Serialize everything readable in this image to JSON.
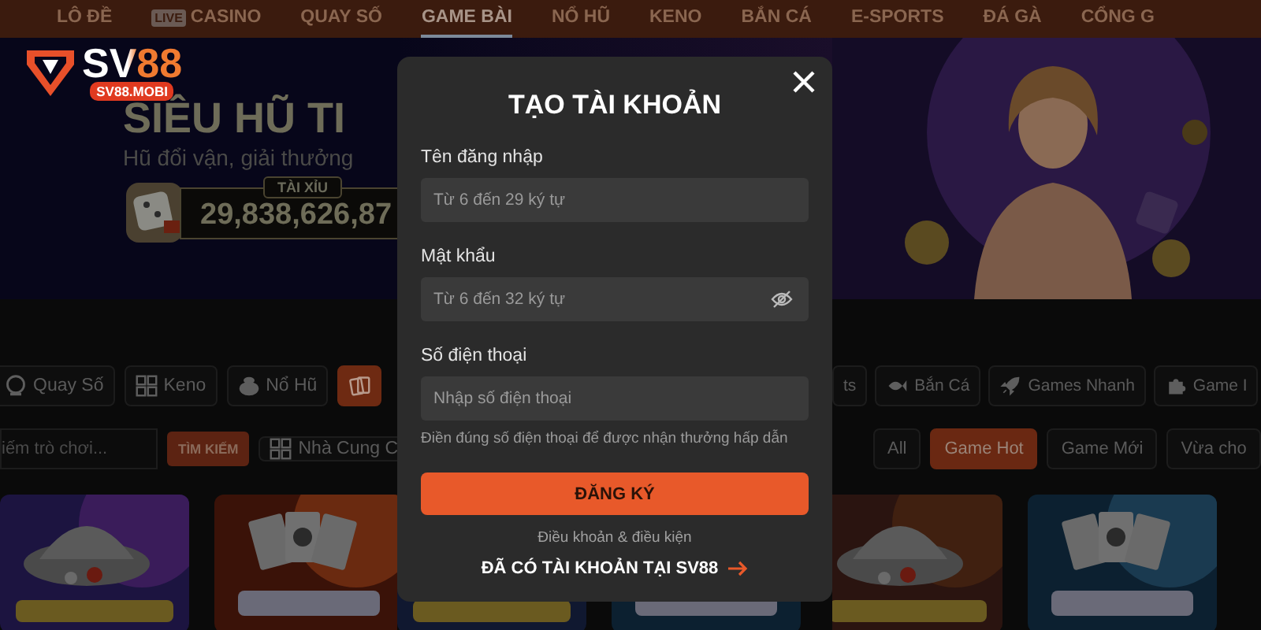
{
  "nav": {
    "items": [
      {
        "label": "LÔ ĐỀ",
        "selected": false
      },
      {
        "label": "CASINO",
        "badge": "LIVE",
        "selected": false
      },
      {
        "label": "QUAY SỐ",
        "selected": false
      },
      {
        "label": "GAME BÀI",
        "selected": true
      },
      {
        "label": "NỔ HŨ",
        "selected": false
      },
      {
        "label": "KENO",
        "selected": false
      },
      {
        "label": "BẮN CÁ",
        "selected": false
      },
      {
        "label": "E-SPORTS",
        "selected": false
      },
      {
        "label": "ĐÁ GÀ",
        "selected": false
      },
      {
        "label": "CỔNG G",
        "selected": false
      }
    ]
  },
  "logo": {
    "name": "SV88",
    "domain": "SV88.MOBI"
  },
  "banner": {
    "title": "SIÊU HŨ TI",
    "subtitle": "Hũ đổi vận, giải thưởng",
    "jackpot_label": "TÀI XỈU",
    "jackpot_amount": "29,838,626,87"
  },
  "categories_left": [
    {
      "label": "Quay Số",
      "selected": false
    },
    {
      "label": "Keno",
      "selected": false
    },
    {
      "label": "Nổ Hũ",
      "selected": false
    },
    {
      "selected": true
    }
  ],
  "categories_right": [
    {
      "label": "ts",
      "selected": false
    },
    {
      "label": "Bắn Cá",
      "selected": false
    },
    {
      "label": "Games Nhanh",
      "selected": false
    },
    {
      "label": "Game I",
      "selected": false
    }
  ],
  "search": {
    "placeholder": "iếm trò chơi...",
    "button": "TÌM KIẾM"
  },
  "provider_filter": "Nhà Cung C",
  "filters": [
    {
      "label": "All",
      "selected": false
    },
    {
      "label": "Game Hot",
      "selected": true
    },
    {
      "label": "Game Mới",
      "selected": false
    },
    {
      "label": "Vừa cho",
      "selected": false
    }
  ],
  "dialog": {
    "title": "TẠO TÀI KHOẢN",
    "fields": [
      {
        "kind": "text",
        "label": "Tên đăng nhập",
        "placeholder": "Từ 6 đến 29 ký tự"
      },
      {
        "kind": "password",
        "label": "Mật khẩu",
        "placeholder": "Từ 6 đến 32 ký tự"
      },
      {
        "kind": "phone",
        "label": "Số điện thoại",
        "placeholder": "Nhập số điện thoại",
        "hint": "Điền đúng số điện thoại để được nhận thưởng hấp dẫn"
      }
    ],
    "submit": "ĐĂNG KÝ",
    "terms": "Điều khoản & điều kiện",
    "login_link": "ĐÃ CÓ TÀI KHOẢN TẠI SV88"
  }
}
